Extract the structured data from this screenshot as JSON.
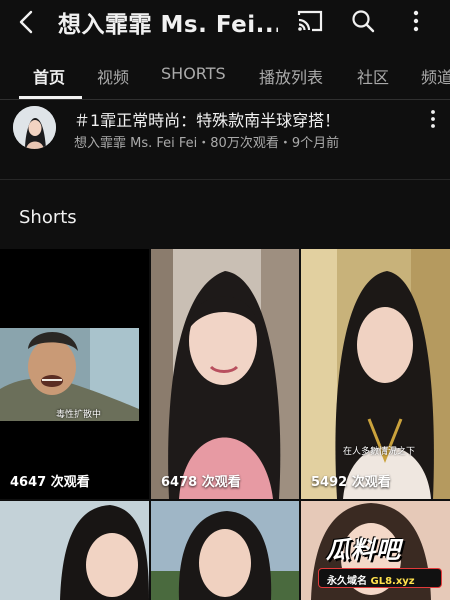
{
  "header": {
    "channel_title": "想入霏霏 Ms. Fei...",
    "icons": [
      "back-icon",
      "cast-icon",
      "search-icon",
      "more-vert-icon"
    ]
  },
  "tabs": [
    {
      "label": "首页",
      "active": true
    },
    {
      "label": "视频",
      "active": false
    },
    {
      "label": "SHORTS",
      "active": false
    },
    {
      "label": "播放列表",
      "active": false
    },
    {
      "label": "社区",
      "active": false
    },
    {
      "label": "频道",
      "active": false
    }
  ],
  "featured_video": {
    "title": "＃1霏正常時尚：特殊款南半球穿搭！",
    "channel": "想入霏霏 Ms. Fei Fei",
    "views": "80万次观看",
    "age": "9个月前",
    "meta_line": "想入霏霏 Ms. Fei Fei・80万次观看・9个月前"
  },
  "shorts": {
    "heading": "Shorts",
    "items": [
      {
        "views": "4647 次观看",
        "caption": "毒性扩散中"
      },
      {
        "views": "6478 次观看"
      },
      {
        "views": "5492 次观看",
        "caption": "在人多數情況之下"
      },
      {},
      {},
      {}
    ]
  },
  "watermark": {
    "logo": "瓜料吧",
    "slogan": "永久域名",
    "site": "GL8.xyz"
  },
  "colors": {
    "background": "#0f0f0f",
    "text_primary": "#f1f1f1",
    "text_secondary": "#aaaaaa",
    "divider": "#303030"
  }
}
